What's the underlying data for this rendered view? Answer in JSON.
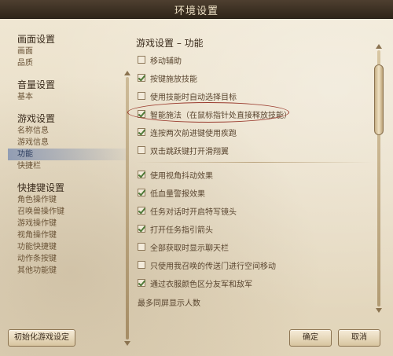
{
  "window": {
    "title": "环境设置"
  },
  "nav": {
    "groups": [
      {
        "header": "画面设置",
        "items": [
          "画面",
          "品质"
        ]
      },
      {
        "header": "音量设置",
        "items": [
          "基本"
        ]
      },
      {
        "header": "游戏设置",
        "items": [
          "名称信息",
          "游戏信息",
          "功能",
          "快捷栏"
        ]
      },
      {
        "header": "快捷键设置",
        "items": [
          "角色操作键",
          "召唤兽操作键",
          "游戏操作键",
          "视角操作键",
          "功能快捷键",
          "动作条按键",
          "其他功能键"
        ]
      }
    ],
    "active": "功能"
  },
  "panel": {
    "title": "游戏设置 – 功能",
    "options": [
      {
        "label": "移动辅助",
        "checked": false
      },
      {
        "label": "按键施放技能",
        "checked": true
      },
      {
        "label": "使用技能时自动选择目标",
        "checked": false
      },
      {
        "label": "智能施法（在鼠标指针处直接释放技能）",
        "checked": true
      },
      {
        "label": "连按两次前进键使用疾跑",
        "checked": true
      },
      {
        "label": "双击跳跃键打开滑翔翼",
        "checked": false
      },
      {
        "label": "使用视角抖动效果",
        "checked": true
      },
      {
        "label": "低血量警报效果",
        "checked": true
      },
      {
        "label": "任务对话时开启特写镜头",
        "checked": true
      },
      {
        "label": "打开任务指引箭头",
        "checked": true
      },
      {
        "label": "全部获取时显示聊天栏",
        "checked": false
      },
      {
        "label": "只使用我召唤的传送门进行空间移动",
        "checked": false
      },
      {
        "label": "通过衣服颜色区分友军和敌军",
        "checked": true
      }
    ],
    "trailing_label": "最多同屏显示人数"
  },
  "buttons": {
    "reset": "初始化游戏设定",
    "ok": "确定",
    "cancel": "取消"
  }
}
